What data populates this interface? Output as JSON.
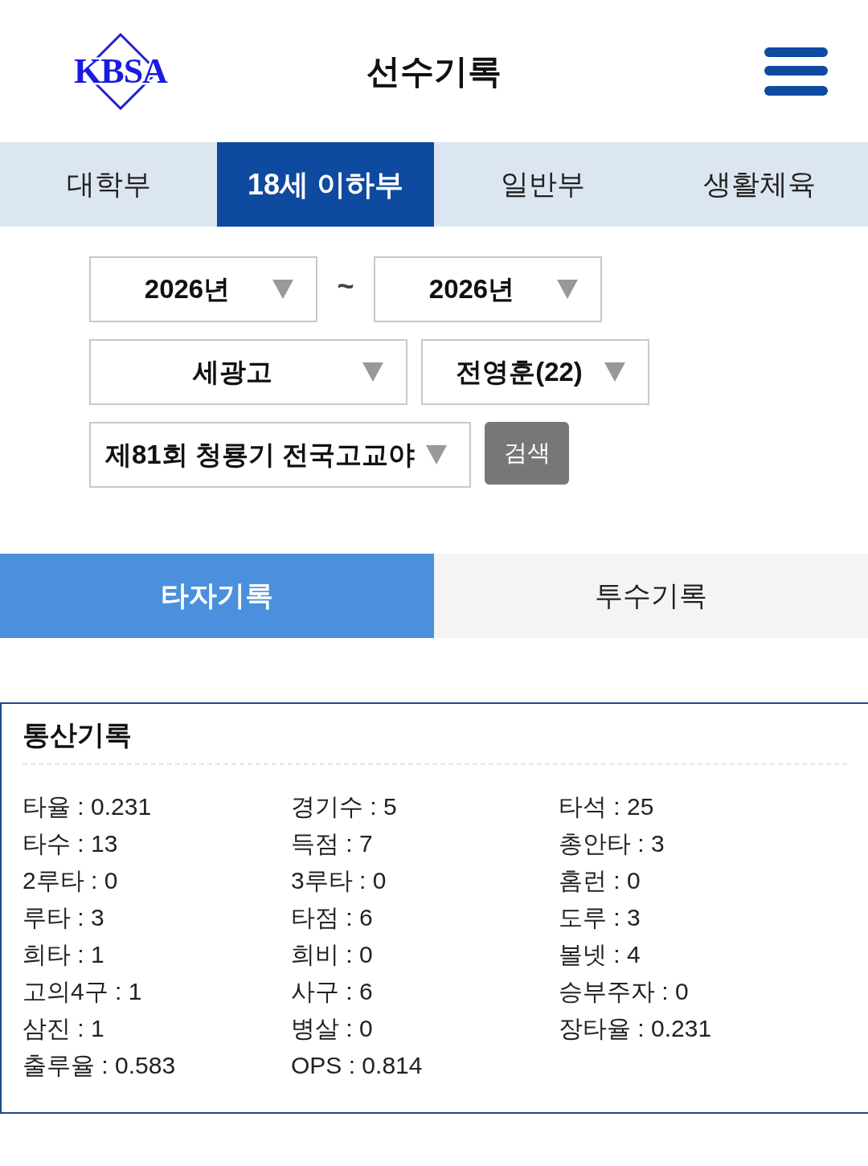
{
  "header": {
    "logo_text": "KBSA",
    "title": "선수기록"
  },
  "division_tabs": [
    {
      "label": "대학부",
      "selected": false
    },
    {
      "label": "18세 이하부",
      "selected": true
    },
    {
      "label": "일반부",
      "selected": false
    },
    {
      "label": "생활체육",
      "selected": false
    }
  ],
  "filters": {
    "year_from": "2026년",
    "range_separator": "~",
    "year_to": "2026년",
    "team": "세광고",
    "player": "전영훈(22)",
    "tournament": "제81회 청룡기 전국고교야",
    "search_button": "검색"
  },
  "record_tabs": [
    {
      "label": "타자기록",
      "selected": true
    },
    {
      "label": "투수기록",
      "selected": false
    }
  ],
  "career_stats": {
    "title": "통산기록",
    "items": [
      "타율 : 0.231",
      "경기수 : 5",
      "타석 : 25",
      "타수 : 13",
      "득점 : 7",
      "총안타 : 3",
      "2루타 : 0",
      "3루타 : 0",
      "홈런 : 0",
      "루타 : 3",
      "타점 : 6",
      "도루 : 3",
      "희타 : 1",
      "희비 : 0",
      "볼넷 : 4",
      "고의4구 : 1",
      "사구 : 6",
      "승부주자 : 0",
      "삼진 : 1",
      "병살 : 0",
      "장타율 : 0.231",
      "출루율 : 0.583",
      "OPS : 0.814"
    ]
  }
}
